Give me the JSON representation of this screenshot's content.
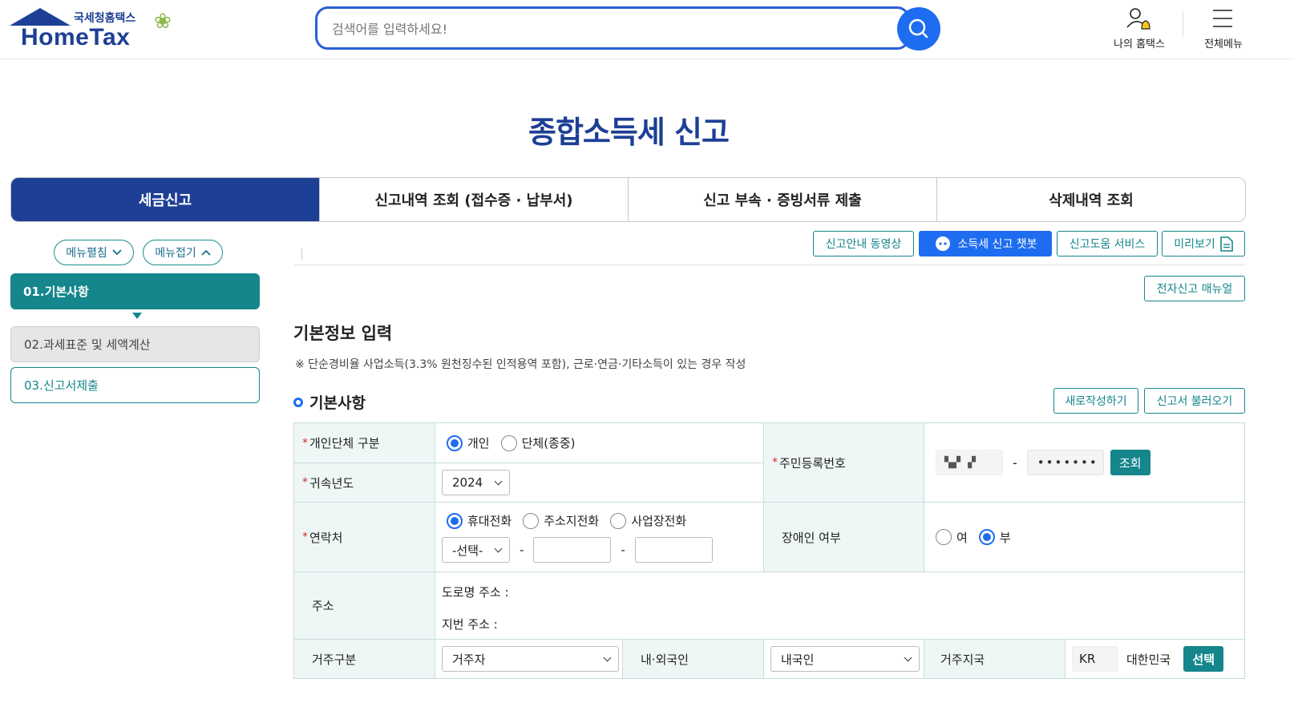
{
  "header": {
    "logo_sub": "국세청홈택스",
    "logo_main": "HomeTax",
    "search_placeholder": "검색어를 입력하세요!",
    "my_hometax": "나의 홈택스",
    "all_menu": "전체메뉴"
  },
  "page_title": "종합소득세 신고",
  "tabs": [
    {
      "label": "세금신고",
      "active": true
    },
    {
      "label": "신고내역 조회 (접수증 · 납부서)",
      "active": false
    },
    {
      "label": "신고 부속 · 증빙서류 제출",
      "active": false
    },
    {
      "label": "삭제내역 조회",
      "active": false
    }
  ],
  "left_menu": {
    "expand": "메뉴펼침",
    "collapse": "메뉴접기",
    "steps": [
      "01.기본사항",
      "02.과세표준 및 세액계산",
      "03.신고서제출"
    ]
  },
  "actions": {
    "video": "신고안내 동영상",
    "chatbot": "소득세 신고 챗봇",
    "help": "신고도움 서비스",
    "preview": "미리보기",
    "manual": "전자신고 매뉴얼",
    "new": "새로작성하기",
    "load": "신고서 불러오기"
  },
  "section_title": "기본정보 입력",
  "notice": "※ 단순경비율 사업소득(3.3% 원천징수된 인적용역 포함), 근로·연금·기타소득이 있는 경우 작성",
  "sub_title": "기본사항",
  "form": {
    "type_label": "개인단체 구분",
    "type_opt1": "개인",
    "type_opt2": "단체(종중)",
    "year_label": "귀속년도",
    "year_value": "2024",
    "rrn_label": "주민등록번호",
    "rrn_front": "▚▞ ▗▘",
    "rrn_dash": "-",
    "rrn_back": "•••••••",
    "rrn_btn": "조회",
    "contact_label": "연락처",
    "contact_opt1": "휴대전화",
    "contact_opt2": "주소지전화",
    "contact_opt3": "사업장전화",
    "contact_select": "-선택-",
    "disabled_label": "장애인 여부",
    "disabled_yes": "여",
    "disabled_no": "부",
    "address_label": "주소",
    "road_address": "도로명 주소 :",
    "lot_address": "지번 주소 :",
    "residence_label": "거주구분",
    "residence_value": "거주자",
    "nationality_label": "내·외국인",
    "nationality_value": "내국인",
    "country_label": "거주지국",
    "country_code": "KR",
    "country_name": "대한민국",
    "country_btn": "선택",
    "required_mark": "*"
  },
  "colors": {
    "brand": "#1d3f95",
    "accent": "#1e6df0",
    "teal": "#14868c"
  }
}
